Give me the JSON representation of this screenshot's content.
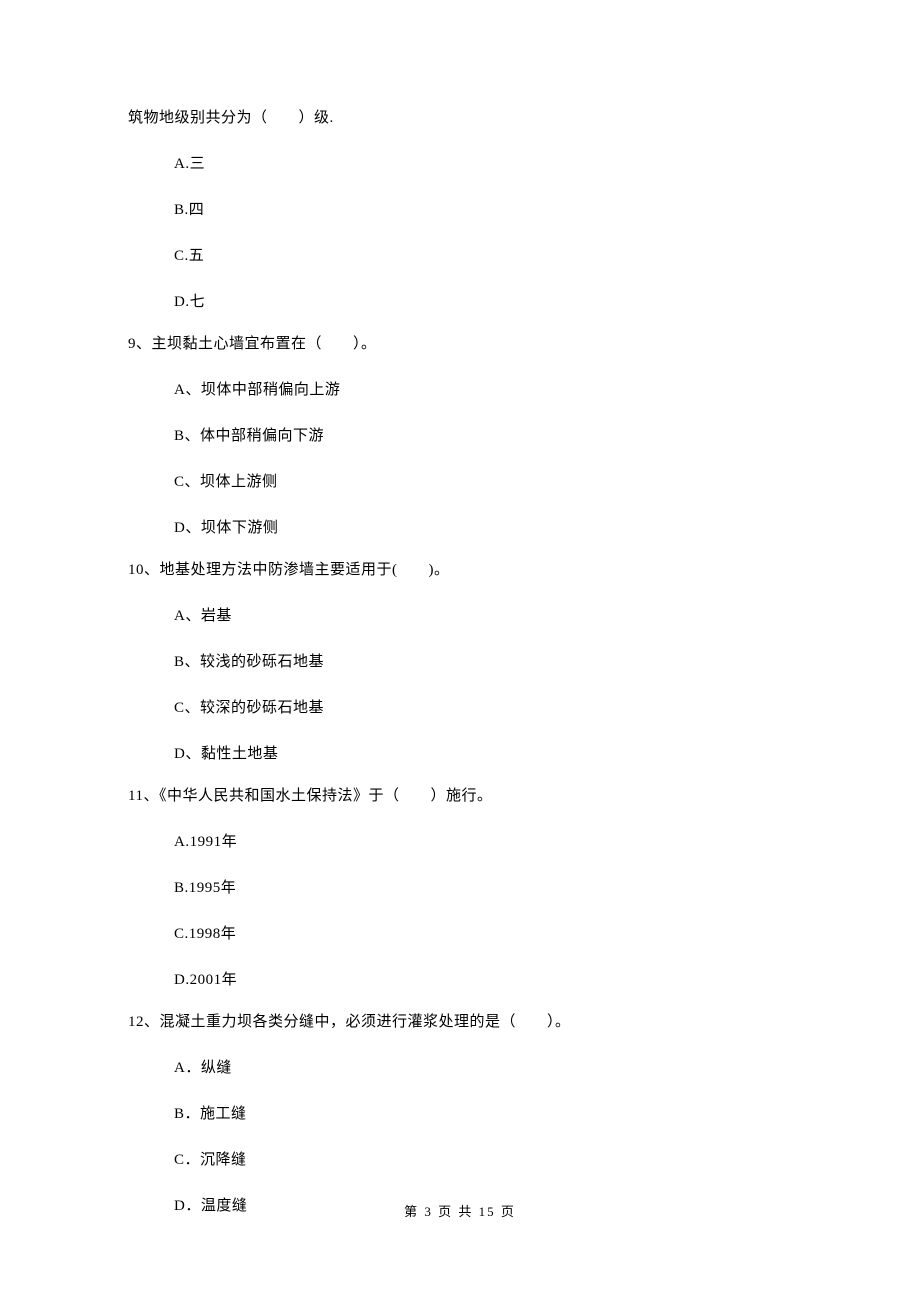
{
  "q8_continuation": {
    "stem": "筑物地级别共分为（　　）级.",
    "options": [
      "A.三",
      "B.四",
      "C.五",
      "D.七"
    ]
  },
  "questions": [
    {
      "number": "9、",
      "stem": "主坝黏土心墙宜布置在（　　）。",
      "options": [
        "A、坝体中部稍偏向上游",
        "B、体中部稍偏向下游",
        "C、坝体上游侧",
        "D、坝体下游侧"
      ]
    },
    {
      "number": "10、",
      "stem": "地基处理方法中防渗墙主要适用于(　　)。",
      "options": [
        "A、岩基",
        "B、较浅的砂砾石地基",
        "C、较深的砂砾石地基",
        "D、黏性土地基"
      ]
    },
    {
      "number": "11、",
      "stem": "《中华人民共和国水土保持法》于（　　）施行。",
      "options": [
        "A.1991年",
        "B.1995年",
        "C.1998年",
        "D.2001年"
      ]
    },
    {
      "number": "12、",
      "stem": "混凝土重力坝各类分缝中，必须进行灌浆处理的是（　　）。",
      "options": [
        "A．纵缝",
        "B．施工缝",
        "C．沉降缝",
        "D．温度缝"
      ]
    }
  ],
  "footer": "第 3 页 共 15 页"
}
